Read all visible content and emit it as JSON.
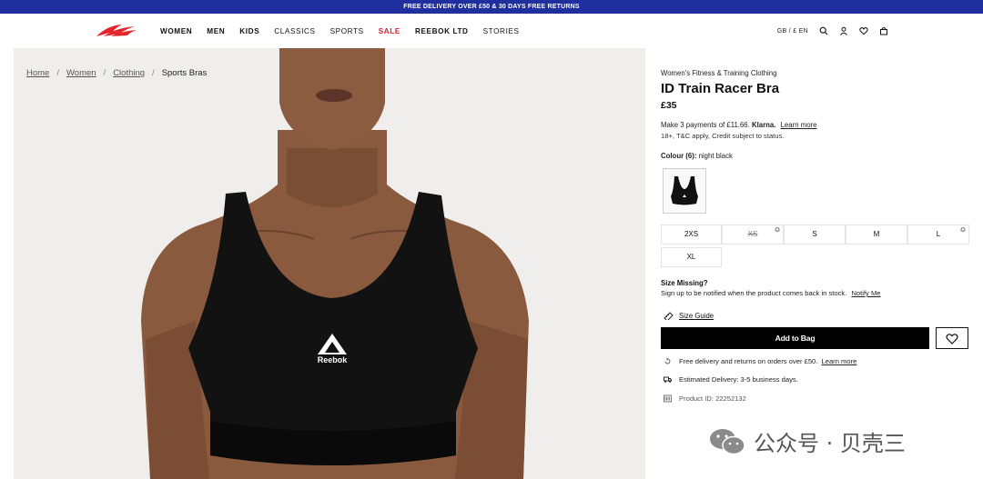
{
  "promo": {
    "text": "FREE DELIVERY OVER £50 & 30 DAYS FREE RETURNS"
  },
  "nav": {
    "items": [
      {
        "label": "WOMEN"
      },
      {
        "label": "MEN"
      },
      {
        "label": "KIDS"
      },
      {
        "label": "CLASSICS"
      },
      {
        "label": "SPORTS"
      },
      {
        "label": "SALE"
      },
      {
        "label": "REEBOK LTD"
      },
      {
        "label": "STORIES"
      }
    ],
    "locale": "GB / £ EN",
    "icons": [
      "search-icon",
      "account-icon",
      "wishlist-icon",
      "bag-icon"
    ]
  },
  "breadcrumb": {
    "items": [
      {
        "label": "Home"
      },
      {
        "label": "Women"
      },
      {
        "label": "Clothing"
      }
    ],
    "sep": "/",
    "current": "Sports Bras"
  },
  "product": {
    "category": "Women's Fitness & Training Clothing",
    "title": "ID Train Racer Bra",
    "price": "£35",
    "klarna_text": "Make 3 payments of £11.66.",
    "klarna_brand": "Klarna.",
    "klarna_link": "Learn more",
    "klarna_note": "18+, T&C apply, Credit subject to status.",
    "colour_label": "Colour (6):",
    "colour_value": "night black",
    "logo_text": "Reebok"
  },
  "sizes": [
    {
      "label": "2XS",
      "available": true
    },
    {
      "label": "XS",
      "available": false
    },
    {
      "label": "S",
      "available": true
    },
    {
      "label": "M",
      "available": true
    },
    {
      "label": "L",
      "available": true
    },
    {
      "label": "XL",
      "available": true
    }
  ],
  "size_missing": {
    "title": "Size Missing?",
    "text": "Sign up to be notified when the product comes back in stock.",
    "link": "Notify Me"
  },
  "size_guide": "Size Guide",
  "add_to_bag": "Add to Bag",
  "info": {
    "delivery_text": "Free delivery and returns on orders over £50.",
    "delivery_link": "Learn more",
    "estimated": "Estimated Delivery: 3-5 business days.",
    "product_id": "Product ID: 22252132"
  },
  "watermark": {
    "text": "公众号 · 贝壳三"
  },
  "colors": {
    "promo_bg": "#1f2f9e",
    "sale": "#d2232a",
    "brand_red": "#e4252b",
    "button": "#000000"
  }
}
